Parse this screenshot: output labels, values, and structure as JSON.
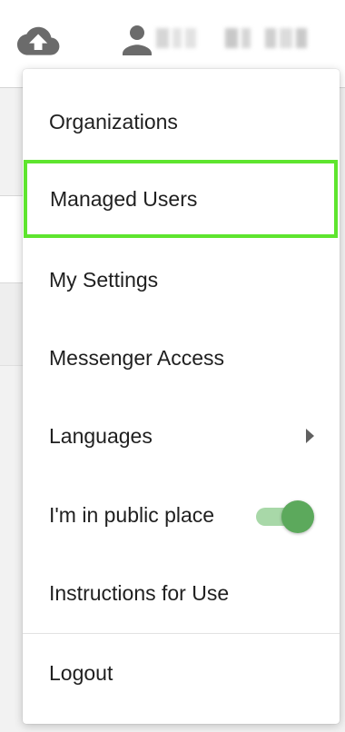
{
  "header": {
    "upload_icon": "cloud-upload-icon",
    "user_icon": "person-icon"
  },
  "menu": {
    "items": [
      {
        "label": "Organizations"
      },
      {
        "label": "Managed Users"
      },
      {
        "label": "My Settings"
      },
      {
        "label": "Messenger Access"
      },
      {
        "label": "Languages",
        "icon": "chevron-right-icon"
      },
      {
        "label": "I'm in public place",
        "toggle_on": true
      },
      {
        "label": "Instructions for Use"
      },
      {
        "label": "Logout"
      }
    ],
    "highlighted_index": 1
  },
  "colors": {
    "highlight_border": "#5ee52e",
    "toggle_knob": "#5ca95c",
    "toggle_track": "#a8d8a8"
  }
}
